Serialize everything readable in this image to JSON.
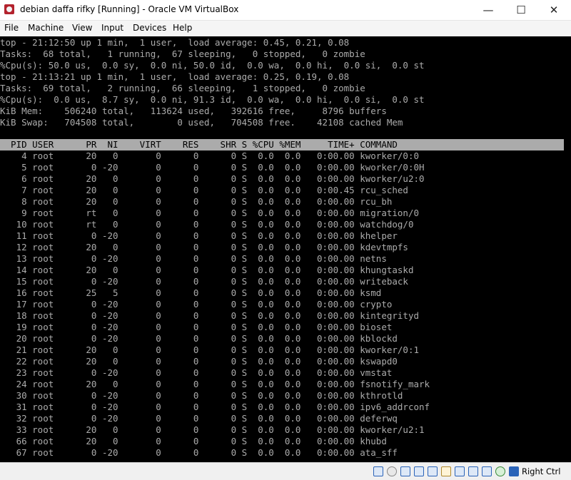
{
  "window": {
    "title": "debian daffa rifky [Running] - Oracle VM VirtualBox",
    "minimize_glyph": "—",
    "maximize_glyph": "☐",
    "close_glyph": "✕"
  },
  "menu": {
    "items": [
      "File",
      "Machine",
      "View",
      "Input",
      "Devices",
      "Help"
    ]
  },
  "console": {
    "lines": [
      "top - 21:12:50 up 1 min,  1 user,  load average: 0.45, 0.21, 0.08",
      "Tasks:  68 total,   1 running,  67 sleeping,   0 stopped,   0 zombie",
      "%Cpu(s): 50.0 us,  0.0 sy,  0.0 ni, 50.0 id,  0.0 wa,  0.0 hi,  0.0 si,  0.0 st",
      "top - 21:13:21 up 1 min,  1 user,  load average: 0.25, 0.19, 0.08",
      "Tasks:  69 total,   2 running,  66 sleeping,   1 stopped,   0 zombie",
      "%Cpu(s):  0.0 us,  8.7 sy,  0.0 ni, 91.3 id,  0.0 wa,  0.0 hi,  0.0 si,  0.0 st",
      "KiB Mem:    506240 total,   113624 used,   392616 free,     8796 buffers",
      "KiB Swap:   704508 total,        0 used,   704508 free.    42108 cached Mem",
      ""
    ],
    "header": "  PID USER      PR  NI    VIRT    RES    SHR S %CPU %MEM     TIME+ COMMAND",
    "rows": [
      "    4 root      20   0       0      0      0 S  0.0  0.0   0:00.00 kworker/0:0",
      "    5 root       0 -20       0      0      0 S  0.0  0.0   0:00.00 kworker/0:0H",
      "    6 root      20   0       0      0      0 S  0.0  0.0   0:00.00 kworker/u2:0",
      "    7 root      20   0       0      0      0 S  0.0  0.0   0:00.45 rcu_sched",
      "    8 root      20   0       0      0      0 S  0.0  0.0   0:00.00 rcu_bh",
      "    9 root      rt   0       0      0      0 S  0.0  0.0   0:00.00 migration/0",
      "   10 root      rt   0       0      0      0 S  0.0  0.0   0:00.00 watchdog/0",
      "   11 root       0 -20       0      0      0 S  0.0  0.0   0:00.00 khelper",
      "   12 root      20   0       0      0      0 S  0.0  0.0   0:00.00 kdevtmpfs",
      "   13 root       0 -20       0      0      0 S  0.0  0.0   0:00.00 netns",
      "   14 root      20   0       0      0      0 S  0.0  0.0   0:00.00 khungtaskd",
      "   15 root       0 -20       0      0      0 S  0.0  0.0   0:00.00 writeback",
      "   16 root      25   5       0      0      0 S  0.0  0.0   0:00.00 ksmd",
      "   17 root       0 -20       0      0      0 S  0.0  0.0   0:00.00 crypto",
      "   18 root       0 -20       0      0      0 S  0.0  0.0   0:00.00 kintegrityd",
      "   19 root       0 -20       0      0      0 S  0.0  0.0   0:00.00 bioset",
      "   20 root       0 -20       0      0      0 S  0.0  0.0   0:00.00 kblockd",
      "   21 root      20   0       0      0      0 S  0.0  0.0   0:00.00 kworker/0:1",
      "   22 root      20   0       0      0      0 S  0.0  0.0   0:00.00 kswapd0",
      "   23 root       0 -20       0      0      0 S  0.0  0.0   0:00.00 vmstat",
      "   24 root      20   0       0      0      0 S  0.0  0.0   0:00.00 fsnotify_mark",
      "   30 root       0 -20       0      0      0 S  0.0  0.0   0:00.00 kthrotld",
      "   31 root       0 -20       0      0      0 S  0.0  0.0   0:00.00 ipv6_addrconf",
      "   32 root       0 -20       0      0      0 S  0.0  0.0   0:00.00 deferwq",
      "   33 root      20   0       0      0      0 S  0.0  0.0   0:00.00 kworker/u2:1",
      "   66 root      20   0       0      0      0 S  0.0  0.0   0:00.00 khubd",
      "   67 root       0 -20       0      0      0 S  0.0  0.0   0:00.00 ata_sff"
    ]
  },
  "statusbar": {
    "icons": [
      "hard-disk-icon",
      "optical-drive-icon",
      "audio-icon",
      "network-icon",
      "usb-icon",
      "shared-folders-icon",
      "display-icon",
      "video-capture-icon",
      "virtualization-icon",
      "mouse-integration-icon",
      "keyboard-capture-icon"
    ],
    "host_key": "Right Ctrl"
  }
}
